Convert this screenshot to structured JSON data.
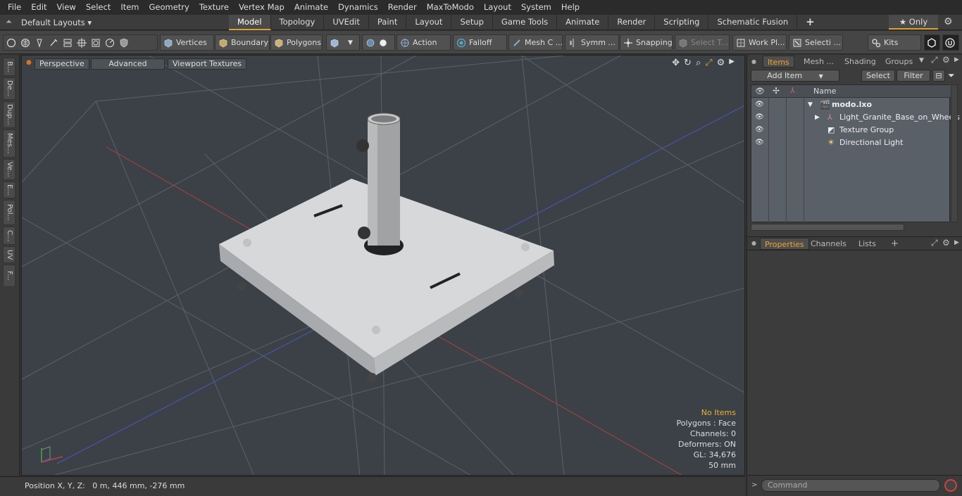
{
  "menubar": {
    "items": [
      "File",
      "Edit",
      "View",
      "Select",
      "Item",
      "Geometry",
      "Texture",
      "Vertex Map",
      "Animate",
      "Dynamics",
      "Render",
      "MaxToModo",
      "Layout",
      "System",
      "Help"
    ]
  },
  "tabrow": {
    "layout_label": "Default Layouts ▾",
    "tabs": [
      "Model",
      "Topology",
      "UVEdit",
      "Paint",
      "Layout",
      "Setup",
      "Game Tools",
      "Animate",
      "Render",
      "Scripting",
      "Schematic Fusion"
    ],
    "active_tab": "Model",
    "add_tab": "+",
    "only_label": "★ Only"
  },
  "toolbar": {
    "vertices": "Vertices",
    "boundary": "Boundary",
    "polygons": "Polygons",
    "action": "Action",
    "falloff": "Falloff",
    "mesh": "Mesh C ...",
    "symm": "Symm ...",
    "snapping": "Snapping",
    "select_t": "Select T...",
    "work_pl": "Work Pl...",
    "selecti": "Selecti ...",
    "kits": "Kits"
  },
  "lefttabs": [
    "B...",
    "De...",
    "Dup...",
    "Mes...",
    "Ve...",
    "E...",
    "Pol...",
    "C...",
    "UV",
    "F..."
  ],
  "viewport": {
    "perspective": "Perspective",
    "advanced": "Advanced",
    "viewport_textures": "Viewport Textures",
    "info": {
      "no_items": "No Items",
      "polygons": "Polygons : Face",
      "channels": "Channels: 0",
      "deformers": "Deformers: ON",
      "gl": "GL: 34,676",
      "scale": "50 mm"
    }
  },
  "statusbar": {
    "position": "Position X, Y, Z:   0 m, 446 mm, -276 mm"
  },
  "items_panel": {
    "tabs": [
      "Items",
      "Mesh ...",
      "Shading",
      "Groups"
    ],
    "add_item": "Add Item",
    "select": "Select",
    "filter": "Filter",
    "name_header": "Name",
    "rows": [
      {
        "name": "modo.lxo"
      },
      {
        "name": "Light_Granite_Base_on_Wheels"
      },
      {
        "name": "Texture Group"
      },
      {
        "name": "Directional Light"
      }
    ]
  },
  "properties_panel": {
    "tabs": [
      "Properties",
      "Channels",
      "Lists"
    ],
    "add": "+"
  },
  "command": {
    "placeholder": "Command"
  },
  "colors": {
    "accent": "#e0a030",
    "viewport_bg": "#3b4147"
  }
}
